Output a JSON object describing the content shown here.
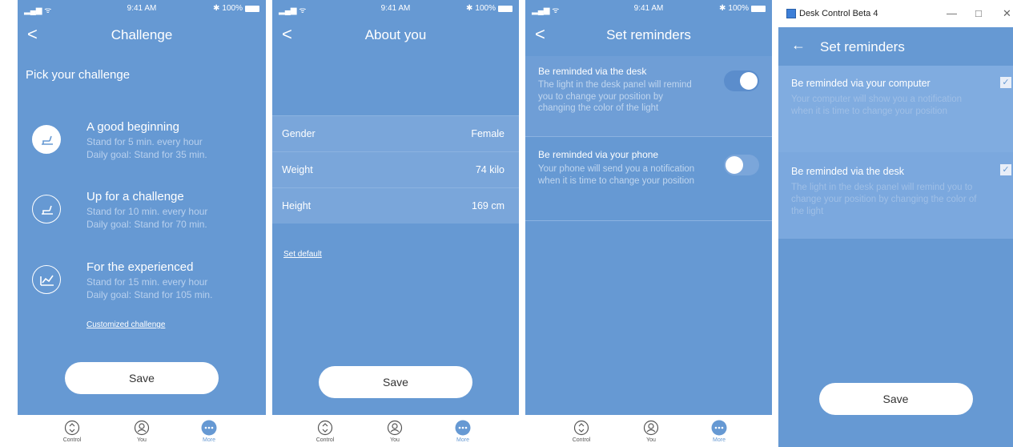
{
  "status": {
    "time": "9:41 AM",
    "battery": "100%"
  },
  "screen1": {
    "back": "<",
    "title": "Challenge",
    "heading": "Pick your challenge",
    "challenges": [
      {
        "title": "A good beginning",
        "line1": "Stand for 5 min. every hour",
        "line2": "Daily goal: Stand for 35 min.",
        "icon": "standing-desk-icon",
        "selected": true
      },
      {
        "title": "Up for a challenge",
        "line1": "Stand for 10 min. every hour",
        "line2": "Daily goal: Stand for 70 min.",
        "icon": "standing-desk-icon",
        "selected": false
      },
      {
        "title": "For the experienced",
        "line1": "Stand for 15 min. every hour",
        "line2": "Daily goal: Stand for 105 min.",
        "icon": "chart-icon",
        "selected": false
      }
    ],
    "custom_link": "Customized challenge",
    "save": "Save"
  },
  "screen2": {
    "back": "<",
    "title": "About you",
    "rows": [
      {
        "label": "Gender",
        "value": "Female"
      },
      {
        "label": "Weight",
        "value": "74 kilo"
      },
      {
        "label": "Height",
        "value": "169 cm"
      }
    ],
    "set_default": "Set default",
    "save": "Save"
  },
  "screen3": {
    "back": "<",
    "title": "Set reminders",
    "reminders": [
      {
        "title": "Be reminded via the desk",
        "desc": "The light in the desk panel will remind you to change your position by changing the color of the light",
        "on": true
      },
      {
        "title": "Be reminded via your phone",
        "desc": "Your phone will send you a notification when it is time to change your position",
        "on": false
      }
    ]
  },
  "tabs": [
    {
      "label": "Control",
      "icon": "control-icon"
    },
    {
      "label": "You",
      "icon": "user-icon"
    },
    {
      "label": "More",
      "icon": "more-icon"
    }
  ],
  "screen4": {
    "window_title": "Desk Control  Beta 4",
    "minimize": "—",
    "maximize": "□",
    "close": "✕",
    "back": "←",
    "title": "Set reminders",
    "rows": [
      {
        "title": "Be reminded via your computer",
        "desc": "Your computer will show you a notification when it is time to change your position",
        "checked": true
      },
      {
        "title": "Be reminded via the desk",
        "desc": "The light in the desk panel will remind you to change your position by changing the color of the light",
        "checked": true
      }
    ],
    "save": "Save"
  },
  "colors": {
    "primary": "#6699d3",
    "row": "#7aa6da",
    "muted_text": "#b8d0ee"
  }
}
